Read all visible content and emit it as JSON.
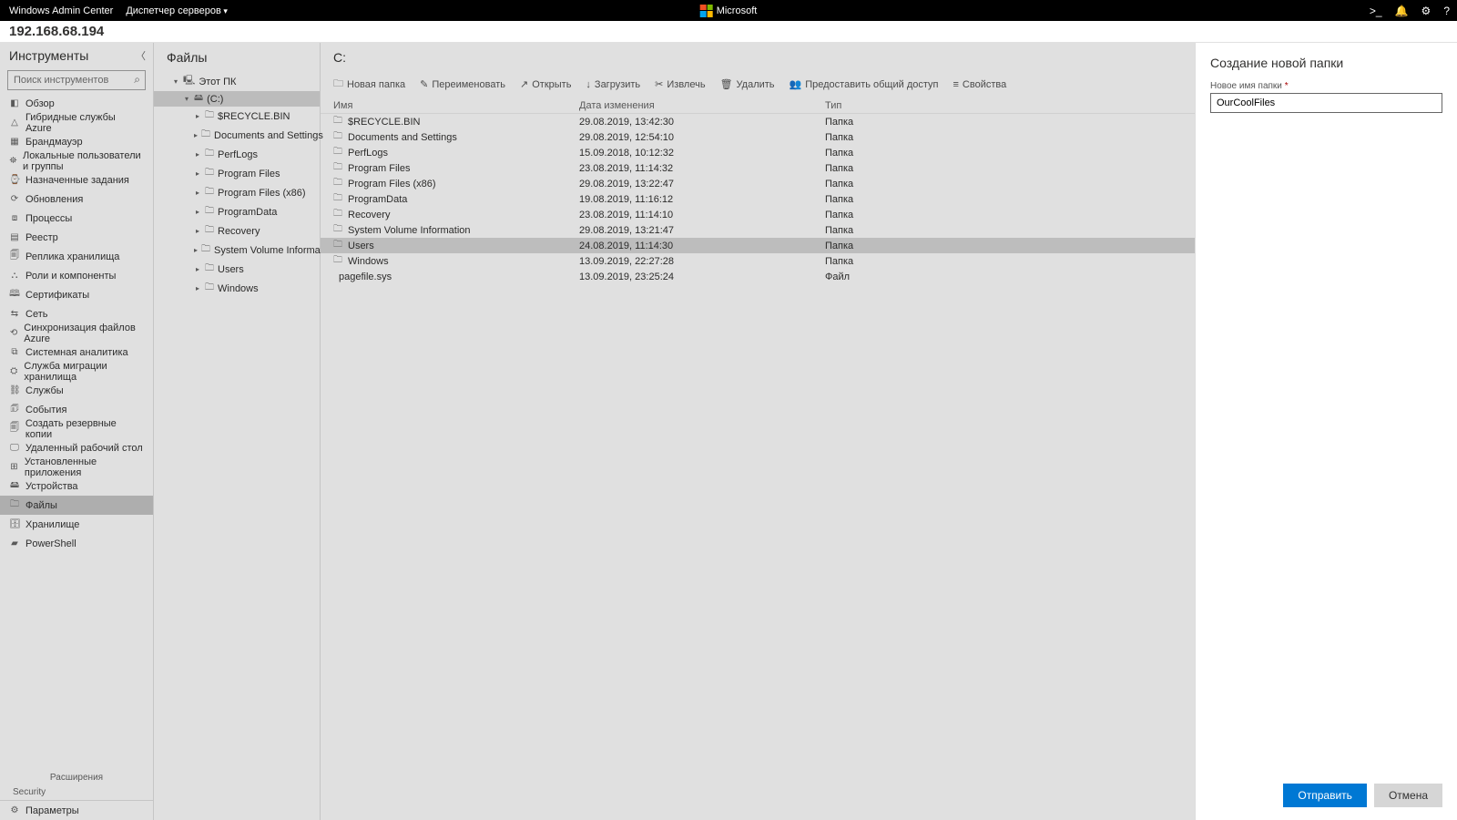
{
  "topbar": {
    "app_name": "Windows Admin Center",
    "menu": "Диспетчер серверов",
    "brand": "Microsoft",
    "icons": {
      "console": ">_",
      "bell": "🔔",
      "gear": "⚙",
      "help": "?"
    }
  },
  "subheader": {
    "host": "192.168.68.194"
  },
  "tools": {
    "title": "Инструменты",
    "search_placeholder": "Поиск инструментов",
    "items": [
      {
        "icon": "◧",
        "label": "Обзор"
      },
      {
        "icon": "△",
        "label": "Гибридные службы Azure"
      },
      {
        "icon": "▦",
        "label": "Брандмауэр"
      },
      {
        "icon": "⛯",
        "label": "Локальные пользователи и группы"
      },
      {
        "icon": "⌚",
        "label": "Назначенные задания"
      },
      {
        "icon": "⟳",
        "label": "Обновления"
      },
      {
        "icon": "⧈",
        "label": "Процессы"
      },
      {
        "icon": "▤",
        "label": "Реестр"
      },
      {
        "icon": "🗐",
        "label": "Реплика хранилища"
      },
      {
        "icon": "⛬",
        "label": "Роли и компоненты"
      },
      {
        "icon": "🕮",
        "label": "Сертификаты"
      },
      {
        "icon": "⇆",
        "label": "Сеть"
      },
      {
        "icon": "⟲",
        "label": "Синхронизация файлов Azure"
      },
      {
        "icon": "⧉",
        "label": "Системная аналитика"
      },
      {
        "icon": "⛭",
        "label": "Служба миграции хранилища"
      },
      {
        "icon": "⛓",
        "label": "Службы"
      },
      {
        "icon": "🗊",
        "label": "События"
      },
      {
        "icon": "🗐",
        "label": "Создать резервные копии"
      },
      {
        "icon": "🖵",
        "label": "Удаленный рабочий стол"
      },
      {
        "icon": "⊞",
        "label": "Установленные приложения"
      },
      {
        "icon": "🖴",
        "label": "Устройства"
      },
      {
        "icon": "🗀",
        "label": "Файлы",
        "active": true
      },
      {
        "icon": "🗄",
        "label": "Хранилище"
      },
      {
        "icon": "▰",
        "label": "PowerShell"
      }
    ],
    "extensions_label": "Расширения",
    "ext_item": "Security",
    "footer": {
      "icon": "⚙",
      "label": "Параметры"
    }
  },
  "tree": {
    "title": "Файлы",
    "root": {
      "icon": "🖳",
      "label": "Этот ПК"
    },
    "drive": {
      "icon": "🖴",
      "label": "(C:)"
    },
    "children": [
      "$RECYCLE.BIN",
      "Documents and Settings",
      "PerfLogs",
      "Program Files",
      "Program Files (x86)",
      "ProgramData",
      "Recovery",
      "System Volume Information",
      "Users",
      "Windows"
    ]
  },
  "files": {
    "path": "C:",
    "toolbar": [
      {
        "icon": "🗀",
        "label": "Новая папка"
      },
      {
        "icon": "✎",
        "label": "Переименовать"
      },
      {
        "icon": "↗",
        "label": "Открыть"
      },
      {
        "icon": "↓",
        "label": "Загрузить"
      },
      {
        "icon": "✂",
        "label": "Извлечь"
      },
      {
        "icon": "🗑",
        "label": "Удалить"
      },
      {
        "icon": "👥",
        "label": "Предоставить общий доступ"
      },
      {
        "icon": "≡",
        "label": "Свойства"
      }
    ],
    "columns": {
      "name": "Имя",
      "date": "Дата изменения",
      "type": "Тип"
    },
    "rows": [
      {
        "name": "$RECYCLE.BIN",
        "date": "29.08.2019, 13:42:30",
        "type": "Папка"
      },
      {
        "name": "Documents and Settings",
        "date": "29.08.2019, 12:54:10",
        "type": "Папка"
      },
      {
        "name": "PerfLogs",
        "date": "15.09.2018, 10:12:32",
        "type": "Папка"
      },
      {
        "name": "Program Files",
        "date": "23.08.2019, 11:14:32",
        "type": "Папка"
      },
      {
        "name": "Program Files (x86)",
        "date": "29.08.2019, 13:22:47",
        "type": "Папка"
      },
      {
        "name": "ProgramData",
        "date": "19.08.2019, 11:16:12",
        "type": "Папка"
      },
      {
        "name": "Recovery",
        "date": "23.08.2019, 11:14:10",
        "type": "Папка"
      },
      {
        "name": "System Volume Information",
        "date": "29.08.2019, 13:21:47",
        "type": "Папка"
      },
      {
        "name": "Users",
        "date": "24.08.2019, 11:14:30",
        "type": "Папка",
        "selected": true
      },
      {
        "name": "Windows",
        "date": "13.09.2019, 22:27:28",
        "type": "Папка"
      },
      {
        "name": "pagefile.sys",
        "date": "13.09.2019, 23:25:24",
        "type": "Файл",
        "isfile": true
      }
    ]
  },
  "panel": {
    "title": "Создание новой папки",
    "field_label": "Новое имя папки",
    "value": "OurCoolFiles",
    "submit": "Отправить",
    "cancel": "Отмена"
  }
}
